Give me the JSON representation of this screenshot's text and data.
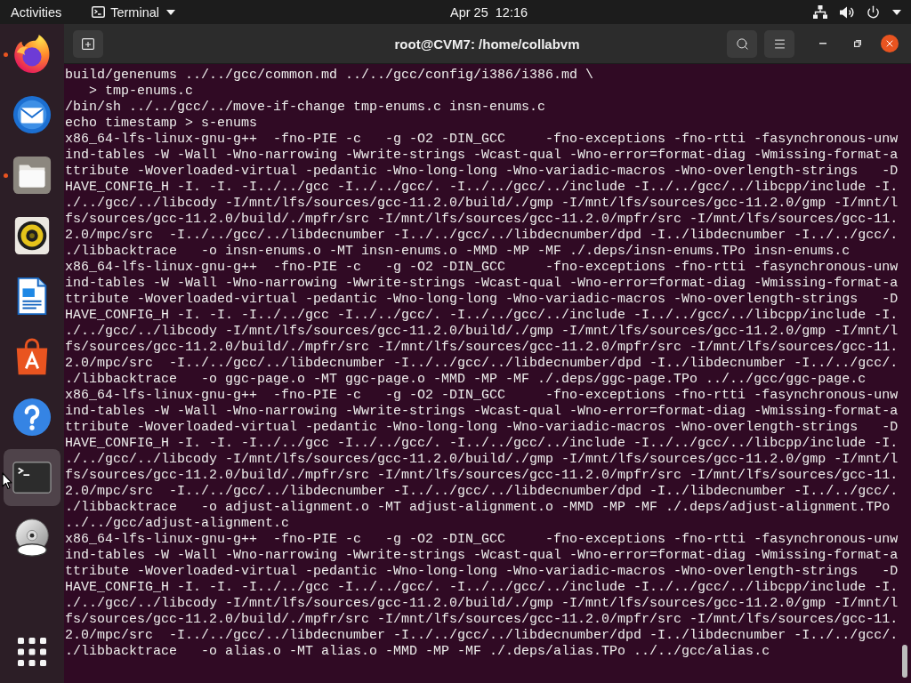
{
  "top_bar": {
    "activities": "Activities",
    "app_menu": "Terminal",
    "clock": "Apr 25  12:16"
  },
  "dock": {
    "items": [
      {
        "kind": "browser",
        "running": true,
        "selected": false
      },
      {
        "kind": "mail",
        "running": false,
        "selected": false
      },
      {
        "kind": "files",
        "running": true,
        "selected": false
      },
      {
        "kind": "music",
        "running": false,
        "selected": false
      },
      {
        "kind": "writer",
        "running": false,
        "selected": false
      },
      {
        "kind": "software",
        "running": false,
        "selected": false
      },
      {
        "kind": "help",
        "running": false,
        "selected": false
      },
      {
        "kind": "terminal",
        "running": false,
        "selected": true
      },
      {
        "kind": "disc",
        "running": false,
        "selected": false
      }
    ]
  },
  "window": {
    "title": "root@CVM7: /home/collabvm"
  },
  "terminal": {
    "output": [
      "build/genenums ../../gcc/common.md ../../gcc/config/i386/i386.md \\",
      "   > tmp-enums.c",
      "/bin/sh ../../gcc/../move-if-change tmp-enums.c insn-enums.c",
      "echo timestamp > s-enums",
      "x86_64-lfs-linux-gnu-g++  -fno-PIE -c   -g -O2 -DIN_GCC     -fno-exceptions -fno-rtti -fasynchronous-unwind-tables -W -Wall -Wno-narrowing -Wwrite-strings -Wcast-qual -Wno-error=format-diag -Wmissing-format-attribute -Woverloaded-virtual -pedantic -Wno-long-long -Wno-variadic-macros -Wno-overlength-strings   -DHAVE_CONFIG_H -I. -I. -I../../gcc -I../../gcc/. -I../../gcc/../include -I../../gcc/../libcpp/include -I../../gcc/../libcody -I/mnt/lfs/sources/gcc-11.2.0/build/./gmp -I/mnt/lfs/sources/gcc-11.2.0/gmp -I/mnt/lfs/sources/gcc-11.2.0/build/./mpfr/src -I/mnt/lfs/sources/gcc-11.2.0/mpfr/src -I/mnt/lfs/sources/gcc-11.2.0/mpc/src  -I../../gcc/../libdecnumber -I../../gcc/../libdecnumber/dpd -I../libdecnumber -I../../gcc/../libbacktrace   -o insn-enums.o -MT insn-enums.o -MMD -MP -MF ./.deps/insn-enums.TPo insn-enums.c",
      "x86_64-lfs-linux-gnu-g++  -fno-PIE -c   -g -O2 -DIN_GCC     -fno-exceptions -fno-rtti -fasynchronous-unwind-tables -W -Wall -Wno-narrowing -Wwrite-strings -Wcast-qual -Wno-error=format-diag -Wmissing-format-attribute -Woverloaded-virtual -pedantic -Wno-long-long -Wno-variadic-macros -Wno-overlength-strings   -DHAVE_CONFIG_H -I. -I. -I../../gcc -I../../gcc/. -I../../gcc/../include -I../../gcc/../libcpp/include -I../../gcc/../libcody -I/mnt/lfs/sources/gcc-11.2.0/build/./gmp -I/mnt/lfs/sources/gcc-11.2.0/gmp -I/mnt/lfs/sources/gcc-11.2.0/build/./mpfr/src -I/mnt/lfs/sources/gcc-11.2.0/mpfr/src -I/mnt/lfs/sources/gcc-11.2.0/mpc/src  -I../../gcc/../libdecnumber -I../../gcc/../libdecnumber/dpd -I../libdecnumber -I../../gcc/../libbacktrace   -o ggc-page.o -MT ggc-page.o -MMD -MP -MF ./.deps/ggc-page.TPo ../../gcc/ggc-page.c",
      "x86_64-lfs-linux-gnu-g++  -fno-PIE -c   -g -O2 -DIN_GCC     -fno-exceptions -fno-rtti -fasynchronous-unwind-tables -W -Wall -Wno-narrowing -Wwrite-strings -Wcast-qual -Wno-error=format-diag -Wmissing-format-attribute -Woverloaded-virtual -pedantic -Wno-long-long -Wno-variadic-macros -Wno-overlength-strings   -DHAVE_CONFIG_H -I. -I. -I../../gcc -I../../gcc/. -I../../gcc/../include -I../../gcc/../libcpp/include -I../../gcc/../libcody -I/mnt/lfs/sources/gcc-11.2.0/build/./gmp -I/mnt/lfs/sources/gcc-11.2.0/gmp -I/mnt/lfs/sources/gcc-11.2.0/build/./mpfr/src -I/mnt/lfs/sources/gcc-11.2.0/mpfr/src -I/mnt/lfs/sources/gcc-11.2.0/mpc/src  -I../../gcc/../libdecnumber -I../../gcc/../libdecnumber/dpd -I../libdecnumber -I../../gcc/../libbacktrace   -o adjust-alignment.o -MT adjust-alignment.o -MMD -MP -MF ./.deps/adjust-alignment.TPo ../../gcc/adjust-alignment.c",
      "x86_64-lfs-linux-gnu-g++  -fno-PIE -c   -g -O2 -DIN_GCC     -fno-exceptions -fno-rtti -fasynchronous-unwind-tables -W -Wall -Wno-narrowing -Wwrite-strings -Wcast-qual -Wno-error=format-diag -Wmissing-format-attribute -Woverloaded-virtual -pedantic -Wno-long-long -Wno-variadic-macros -Wno-overlength-strings   -DHAVE_CONFIG_H -I. -I. -I../../gcc -I../../gcc/. -I../../gcc/../include -I../../gcc/../libcpp/include -I../../gcc/../libcody -I/mnt/lfs/sources/gcc-11.2.0/build/./gmp -I/mnt/lfs/sources/gcc-11.2.0/gmp -I/mnt/lfs/sources/gcc-11.2.0/build/./mpfr/src -I/mnt/lfs/sources/gcc-11.2.0/mpfr/src -I/mnt/lfs/sources/gcc-11.2.0/mpc/src  -I../../gcc/../libdecnumber -I../../gcc/../libdecnumber/dpd -I../libdecnumber -I../../gcc/../libbacktrace   -o alias.o -MT alias.o -MMD -MP -MF ./.deps/alias.TPo ../../gcc/alias.c"
    ]
  }
}
